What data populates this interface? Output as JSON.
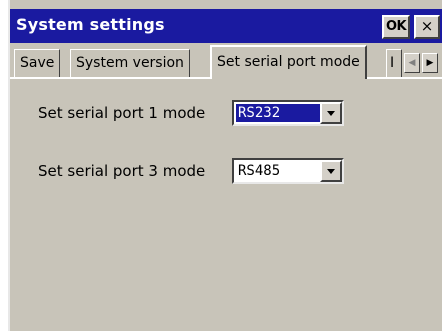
{
  "window": {
    "title": "System settings",
    "ok_label": "OK",
    "close_label": "×"
  },
  "tabs": [
    {
      "label": "Save",
      "active": false
    },
    {
      "label": "System version",
      "active": false
    },
    {
      "label": "Set serial port mode",
      "active": true
    },
    {
      "label": "I",
      "active": false,
      "partial": true
    }
  ],
  "tab_scroll": {
    "left_icon": "scroll-left-icon",
    "right_icon": "scroll-right-icon",
    "left_glyph": "◀",
    "right_glyph": "▶"
  },
  "fields": [
    {
      "label": "Set serial port 1 mode",
      "value": "RS232",
      "selected": true
    },
    {
      "label": "Set serial port 3 mode",
      "value": "RS485",
      "selected": false
    }
  ],
  "colors": {
    "titlebar": "#1a1aa0",
    "face": "#c8c4b9",
    "selection": "#1a1aa0"
  }
}
